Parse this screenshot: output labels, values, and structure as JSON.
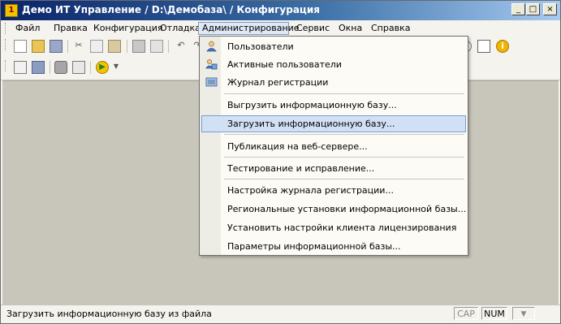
{
  "window": {
    "title": "Демо ИТ Управление / D:\\Демобаза\\ / Конфигурация",
    "app_icon": "1c-app-icon",
    "controls": {
      "minimize": "_",
      "maximize": "□",
      "close": "×"
    }
  },
  "menubar": {
    "items": [
      {
        "id": "file",
        "label": "Файл"
      },
      {
        "id": "edit",
        "label": "Правка"
      },
      {
        "id": "config",
        "label": "Конфигурация"
      },
      {
        "id": "debug",
        "label": "Отладка"
      },
      {
        "id": "admin",
        "label": "Администрирование"
      },
      {
        "id": "service",
        "label": "Сервис"
      },
      {
        "id": "windows",
        "label": "Окна"
      },
      {
        "id": "help",
        "label": "Справка"
      }
    ]
  },
  "dropdown": {
    "items": [
      {
        "label": "Пользователи",
        "icon": "users-icon"
      },
      {
        "label": "Активные пользователи",
        "icon": "active-users-icon"
      },
      {
        "label": "Журнал регистрации",
        "icon": "event-log-icon"
      },
      {
        "label": "Выгрузить информационную базу..."
      },
      {
        "label": "Загрузить информационную базу...",
        "highlighted": true
      },
      {
        "label": "Публикация на веб-сервере..."
      },
      {
        "label": "Тестирование и исправление..."
      },
      {
        "label": "Настройка журнала регистрации..."
      },
      {
        "label": "Региональные установки информационной базы..."
      },
      {
        "label": "Установить настройки клиента лицензирования"
      },
      {
        "label": "Параметры информационной базы..."
      }
    ]
  },
  "statusbar": {
    "text": "Загрузить информационную базу из файла",
    "cap": "CAP",
    "num": "NUM",
    "extra": "▼"
  },
  "colors": {
    "titlebar_start": "#0a246a",
    "titlebar_end": "#a6caf0",
    "menu_highlight": "#d2e0f5",
    "workspace": "#c8c6bb"
  }
}
